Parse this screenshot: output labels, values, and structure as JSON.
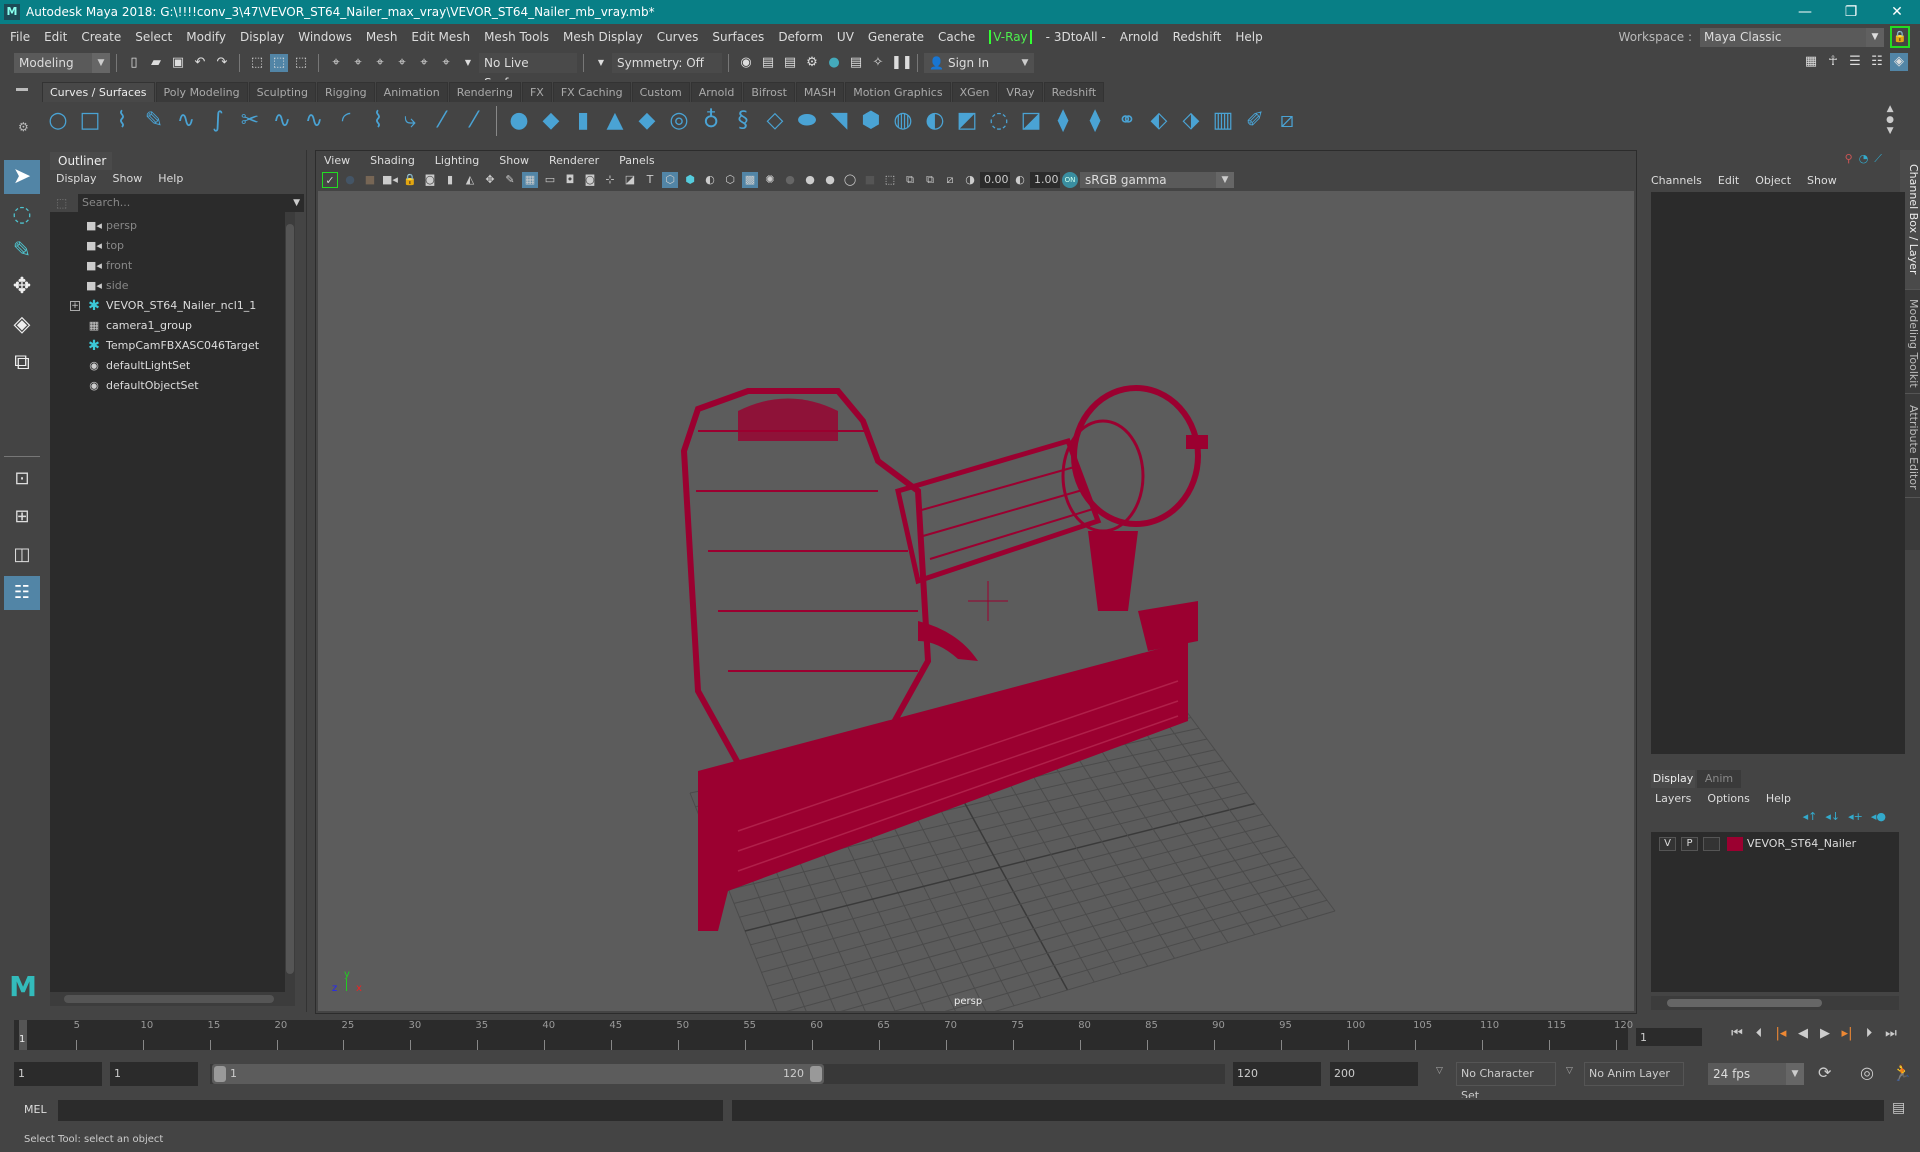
{
  "title": {
    "app_title": "Autodesk Maya 2018: G:\\!!!!conv_3\\47\\VEVOR_ST64_Nailer_max_vray\\VEVOR_ST64_Nailer_mb_vray.mb*",
    "minimize": "—",
    "restore": "❐",
    "close": "✕"
  },
  "menubar": {
    "items": [
      "File",
      "Edit",
      "Create",
      "Select",
      "Modify",
      "Display",
      "Windows",
      "Mesh",
      "Edit Mesh",
      "Mesh Tools",
      "Mesh Display",
      "Curves",
      "Surfaces",
      "Deform",
      "UV",
      "Generate",
      "Cache"
    ],
    "vray": "V-Ray",
    "items_after": [
      "- 3DtoAll -",
      "Arnold",
      "Redshift",
      "Help"
    ],
    "workspace_label": "Workspace :",
    "workspace_value": "Maya Classic"
  },
  "statusline": {
    "menuset": "Modeling",
    "live_surface": "No Live Surface",
    "symmetry": "Symmetry: Off",
    "sign_in": "Sign In"
  },
  "shelf": {
    "tabs": [
      "Curves / Surfaces",
      "Poly Modeling",
      "Sculpting",
      "Rigging",
      "Animation",
      "Rendering",
      "FX",
      "FX Caching",
      "Custom",
      "Arnold",
      "Bifrost",
      "MASH",
      "Motion Graphics",
      "XGen",
      "VRay",
      "Redshift"
    ],
    "active_tab": "Curves / Surfaces"
  },
  "outliner": {
    "tab": "Outliner",
    "menu": [
      "Display",
      "Show",
      "Help"
    ],
    "search_placeholder": "Search...",
    "items": [
      {
        "label": "persp",
        "icon": "camera-icon",
        "dim": true
      },
      {
        "label": "top",
        "icon": "camera-icon",
        "dim": true
      },
      {
        "label": "front",
        "icon": "camera-icon",
        "dim": true
      },
      {
        "label": "side",
        "icon": "camera-icon",
        "dim": true
      },
      {
        "label": "VEVOR_ST64_Nailer_ncl1_1",
        "icon": "transform-icon",
        "expandable": true
      },
      {
        "label": "camera1_group",
        "icon": "group-icon"
      },
      {
        "label": "TempCamFBXASC046Target",
        "icon": "transform-icon"
      },
      {
        "label": "defaultLightSet",
        "icon": "set-icon"
      },
      {
        "label": "defaultObjectSet",
        "icon": "set-icon"
      }
    ]
  },
  "viewport": {
    "menu": [
      "View",
      "Shading",
      "Lighting",
      "Show",
      "Renderer",
      "Panels"
    ],
    "exposure": "0.00",
    "gamma": "1.00",
    "color_space": "sRGB gamma",
    "camera_label": "persp",
    "axis": {
      "x": "x",
      "y": "y",
      "z": "z"
    },
    "wire_color": "#9b0030"
  },
  "channelbox": {
    "menu": [
      "Channels",
      "Edit",
      "Object",
      "Show"
    ],
    "side_tabs": [
      "Channel Box / Layer Editor",
      "Modeling Toolkit",
      "Attribute Editor"
    ]
  },
  "layereditor": {
    "tabs": [
      "Display",
      "Anim"
    ],
    "menu": [
      "Layers",
      "Options",
      "Help"
    ],
    "layer": {
      "v": "V",
      "p": "P",
      "name": "VEVOR_ST64_Nailer",
      "color": "#9b0030"
    }
  },
  "timeline": {
    "ticks": [
      5,
      10,
      15,
      20,
      25,
      30,
      35,
      40,
      45,
      50,
      55,
      60,
      65,
      70,
      75,
      80,
      85,
      90,
      95,
      100,
      105,
      110,
      115,
      120
    ],
    "start": 1,
    "end": 120,
    "current_frame": "1",
    "current_marker": "1"
  },
  "range": {
    "start_field": "1",
    "playback_start": "1",
    "slider_start": "1",
    "slider_end": "120",
    "playback_end": "120",
    "end_field": "200",
    "character_set": "No Character Set",
    "anim_layer": "No Anim Layer",
    "fps": "24 fps"
  },
  "mel": {
    "label": "MEL"
  },
  "helpline": {
    "text": "Select Tool: select an object"
  }
}
